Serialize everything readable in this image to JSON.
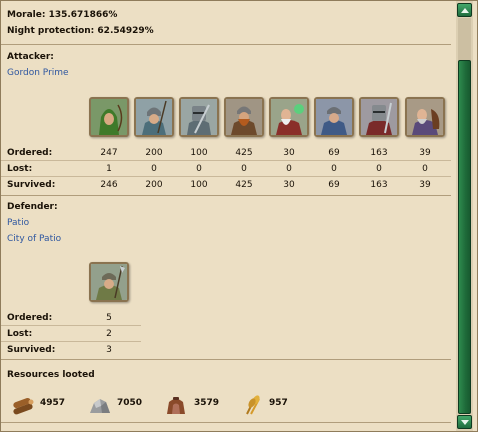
{
  "header": {
    "morale": "Morale: 135.671866%",
    "night_protection": "Night protection: 62.54929%"
  },
  "attacker": {
    "heading": "Attacker:",
    "player": "Gordon Prime",
    "units": [
      {
        "name": "archer-icon",
        "ordered": "247",
        "lost": "1",
        "survived": "246"
      },
      {
        "name": "spearman-icon",
        "ordered": "200",
        "lost": "0",
        "survived": "200"
      },
      {
        "name": "swordsman-icon",
        "ordered": "100",
        "lost": "0",
        "survived": "100"
      },
      {
        "name": "axeman-icon",
        "ordered": "425",
        "lost": "0",
        "survived": "425"
      },
      {
        "name": "mage-icon",
        "ordered": "30",
        "lost": "0",
        "survived": "30"
      },
      {
        "name": "light-cavalry-icon",
        "ordered": "69",
        "lost": "0",
        "survived": "69"
      },
      {
        "name": "heavy-cavalry-icon",
        "ordered": "163",
        "lost": "0",
        "survived": "163"
      },
      {
        "name": "noble-icon",
        "ordered": "39",
        "lost": "0",
        "survived": "39"
      }
    ]
  },
  "defender": {
    "heading": "Defender:",
    "player": "Patio",
    "village": "City of Patio",
    "units": [
      {
        "name": "spearman-icon",
        "ordered": "5",
        "lost": "2",
        "survived": "3"
      }
    ]
  },
  "labels": {
    "ordered": "Ordered:",
    "lost": "Lost:",
    "survived": "Survived:"
  },
  "resources": {
    "heading": "Resources looted",
    "items": [
      {
        "name": "wood-icon",
        "value": "4957"
      },
      {
        "name": "stone-icon",
        "value": "7050"
      },
      {
        "name": "iron-icon",
        "value": "3579"
      },
      {
        "name": "grain-icon",
        "value": "957"
      }
    ]
  },
  "colors": {
    "background": "#ecdfc4",
    "link": "#2f57a0",
    "scrollbar": "#1f6d3e"
  }
}
